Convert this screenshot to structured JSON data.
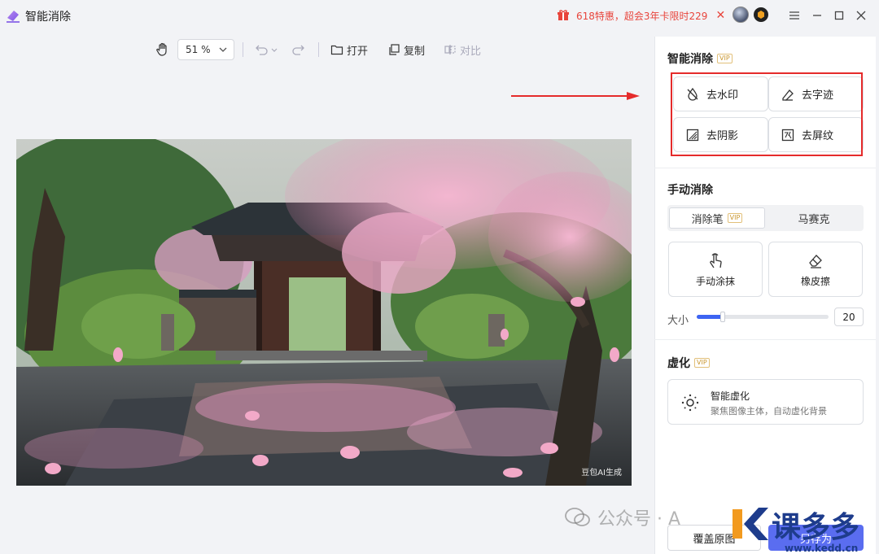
{
  "app": {
    "title": "智能消除",
    "logo": "eraser-logo"
  },
  "promo": {
    "text": "618特惠，超会3年卡限时229",
    "icon": "gift-icon"
  },
  "window_controls": [
    "menu",
    "minimize",
    "maximize",
    "close"
  ],
  "toolbar": {
    "zoom": "51 %",
    "open_label": "打开",
    "copy_label": "复制",
    "compare_label": "对比"
  },
  "image": {
    "watermark": "豆包AI生成"
  },
  "panel": {
    "smart": {
      "title": "智能消除",
      "vip": "VIP",
      "tools": [
        "去水印",
        "去字迹",
        "去阴影",
        "去屏纹"
      ]
    },
    "manual": {
      "title": "手动消除",
      "tabs": [
        {
          "label": "消除笔",
          "vip": "VIP",
          "active": true
        },
        {
          "label": "马赛克",
          "active": false
        }
      ],
      "brush_tools": [
        "手动涂抹",
        "橡皮擦"
      ],
      "size_label": "大小",
      "size_value": "20",
      "size_fraction": 0.2
    },
    "blur": {
      "title": "虚化",
      "vip": "VIP",
      "card_title": "智能虚化",
      "card_desc": "聚焦图像主体，自动虚化背景"
    },
    "bottom": {
      "cover_label": "覆盖原图",
      "save_label": "另存为"
    }
  },
  "overlay": {
    "wechat_text": "公众号 · A",
    "site_text": "课多多",
    "site_url": "www.kedd.cn"
  },
  "colors": {
    "accent": "#3d64f2",
    "highlight": "#e52b2b",
    "promo": "#e8453c",
    "vip": "#c9962e"
  }
}
